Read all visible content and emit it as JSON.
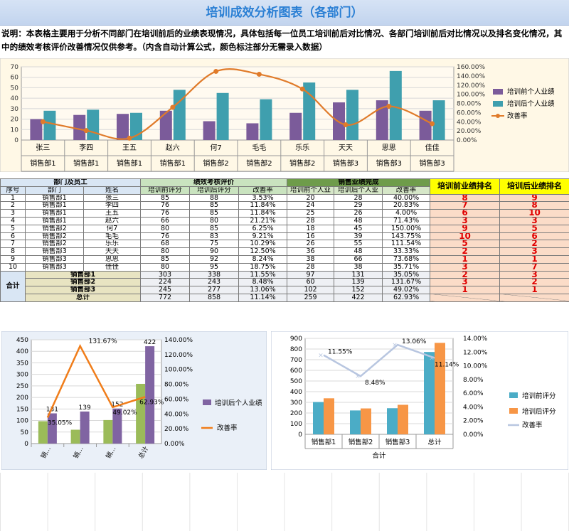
{
  "title": "培训成效分析图表（各部门）",
  "description": "说明：本表格主要用于分析不同部门在培训前后的业绩表现情况，具体包括每一位员工培训前后对比情况、各部门培训前后对比情况以及排名变化情况，其中的绩效考核评价改善情况仅供参考。（内含自动计算公式，颜色标注部分无需录入数据）",
  "table": {
    "group_headers": {
      "dept": "部门及员工",
      "perf": "绩效考核评价",
      "sales": "销售业绩完成",
      "rank_before": "培训前业绩排名",
      "rank_after": "培训后业绩排名"
    },
    "sub_headers": {
      "no": "序号",
      "dept": "部门",
      "name": "姓名",
      "perf_before": "培训前评分",
      "perf_after": "培训后评分",
      "perf_rate": "改善率",
      "sales_before": "培训前个人业",
      "sales_after": "培训后个人业",
      "sales_rate": "改善率"
    },
    "rows": [
      {
        "no": "1",
        "dept": "销售部1",
        "name": "张三",
        "pb": "85",
        "pa": "88",
        "pr": "3.53%",
        "sb": "20",
        "sa": "28",
        "sr": "40.00%",
        "rb": "8",
        "ra": "9"
      },
      {
        "no": "2",
        "dept": "销售部1",
        "name": "李四",
        "pb": "76",
        "pa": "85",
        "pr": "11.84%",
        "sb": "24",
        "sa": "29",
        "sr": "20.83%",
        "rb": "7",
        "ra": "8"
      },
      {
        "no": "3",
        "dept": "销售部1",
        "name": "王五",
        "pb": "76",
        "pa": "85",
        "pr": "11.84%",
        "sb": "25",
        "sa": "26",
        "sr": "4.00%",
        "rb": "6",
        "ra": "10"
      },
      {
        "no": "4",
        "dept": "销售部1",
        "name": "赵六",
        "pb": "66",
        "pa": "80",
        "pr": "21.21%",
        "sb": "28",
        "sa": "48",
        "sr": "71.43%",
        "rb": "3",
        "ra": "3"
      },
      {
        "no": "5",
        "dept": "销售部2",
        "name": "何7",
        "pb": "80",
        "pa": "85",
        "pr": "6.25%",
        "sb": "18",
        "sa": "45",
        "sr": "150.00%",
        "rb": "9",
        "ra": "5"
      },
      {
        "no": "6",
        "dept": "销售部2",
        "name": "毛毛",
        "pb": "76",
        "pa": "83",
        "pr": "9.21%",
        "sb": "16",
        "sa": "39",
        "sr": "143.75%",
        "rb": "10",
        "ra": "6"
      },
      {
        "no": "7",
        "dept": "销售部2",
        "name": "乐乐",
        "pb": "68",
        "pa": "75",
        "pr": "10.29%",
        "sb": "26",
        "sa": "55",
        "sr": "111.54%",
        "rb": "5",
        "ra": "2"
      },
      {
        "no": "8",
        "dept": "销售部3",
        "name": "天天",
        "pb": "80",
        "pa": "90",
        "pr": "12.50%",
        "sb": "36",
        "sa": "48",
        "sr": "33.33%",
        "rb": "2",
        "ra": "3"
      },
      {
        "no": "9",
        "dept": "销售部3",
        "name": "思思",
        "pb": "85",
        "pa": "92",
        "pr": "8.24%",
        "sb": "38",
        "sa": "66",
        "sr": "73.68%",
        "rb": "1",
        "ra": "1"
      },
      {
        "no": "10",
        "dept": "销售部3",
        "name": "佳佳",
        "pb": "80",
        "pa": "95",
        "pr": "18.75%",
        "sb": "28",
        "sa": "38",
        "sr": "35.71%",
        "rb": "3",
        "ra": "7"
      }
    ],
    "total_label": "合计",
    "dept_totals": [
      {
        "dept": "销售部1",
        "pb": "303",
        "pa": "338",
        "pr": "11.55%",
        "sb": "97",
        "sa": "131",
        "sr": "35.05%",
        "rb": "2",
        "ra": "3"
      },
      {
        "dept": "销售部2",
        "pb": "224",
        "pa": "243",
        "pr": "8.48%",
        "sb": "60",
        "sa": "139",
        "sr": "131.67%",
        "rb": "3",
        "ra": "2"
      },
      {
        "dept": "销售部3",
        "pb": "245",
        "pa": "277",
        "pr": "13.06%",
        "sb": "102",
        "sa": "152",
        "sr": "49.02%",
        "rb": "1",
        "ra": "1"
      }
    ],
    "grand_total": {
      "dept": "总计",
      "pb": "772",
      "pa": "858",
      "pr": "11.14%",
      "sb": "259",
      "sa": "422",
      "sr": "62.93%"
    }
  },
  "chart_data": [
    {
      "type": "bar",
      "categories": [
        "张三",
        "李四",
        "王五",
        "赵六",
        "何7",
        "毛毛",
        "乐乐",
        "天天",
        "思思",
        "佳佳"
      ],
      "category_groups": [
        "销售部1",
        "销售部1",
        "销售部1",
        "销售部1",
        "销售部2",
        "销售部2",
        "销售部2",
        "销售部3",
        "销售部3",
        "销售部3"
      ],
      "series": [
        {
          "name": "培训前个人业绩",
          "type": "bar",
          "values": [
            20,
            24,
            25,
            28,
            18,
            16,
            26,
            36,
            38,
            28
          ],
          "color": "#7b5b9a"
        },
        {
          "name": "培训后个人业绩",
          "type": "bar",
          "values": [
            28,
            29,
            26,
            48,
            45,
            39,
            55,
            48,
            66,
            38
          ],
          "color": "#3f9fae"
        },
        {
          "name": "改善率",
          "type": "line",
          "axis": "right",
          "values": [
            40.0,
            20.83,
            4.0,
            71.43,
            150.0,
            143.75,
            111.54,
            33.33,
            73.68,
            35.71
          ],
          "color": "#e07b2a"
        }
      ],
      "ylim": [
        0,
        70
      ],
      "yticks": [
        "0",
        "10",
        "20",
        "30",
        "40",
        "50",
        "60",
        "70"
      ],
      "y2lim": [
        0,
        160
      ],
      "y2ticks": [
        "0.00%",
        "20.00%",
        "40.00%",
        "60.00%",
        "80.00%",
        "100.00%",
        "120.00%",
        "140.00%",
        "160.00%"
      ],
      "legend": [
        "培训前个人业绩",
        "培训后个人业绩",
        "改善率"
      ],
      "legend_position": "right",
      "grid": true
    },
    {
      "type": "bar",
      "categories": [
        "销…",
        "销…",
        "销…",
        "总计"
      ],
      "series": [
        {
          "name": "",
          "type": "bar",
          "values": [
            97,
            60,
            102,
            259
          ],
          "color": "#9bbb59"
        },
        {
          "name": "培训后个人业绩",
          "type": "bar",
          "values": [
            131,
            139,
            152,
            422
          ],
          "color": "#8064a2"
        },
        {
          "name": "改善率",
          "type": "line",
          "axis": "right",
          "values": [
            35.05,
            131.67,
            49.02,
            62.93
          ],
          "color": "#f07d1a"
        }
      ],
      "bar_labels": [
        "131",
        "139",
        "152",
        "422"
      ],
      "rate_labels": [
        "35.05%",
        "131.67%",
        "49.02%",
        "62.93%"
      ],
      "ylim": [
        0,
        450
      ],
      "yticks": [
        "0",
        "50",
        "100",
        "150",
        "200",
        "250",
        "300",
        "350",
        "400",
        "450"
      ],
      "y2lim": [
        0,
        140
      ],
      "y2ticks": [
        "0.00%",
        "20.00%",
        "40.00%",
        "60.00%",
        "80.00%",
        "100.00%",
        "120.00%",
        "140.00%"
      ],
      "legend": [
        "培训后个人业绩",
        "改善率"
      ],
      "legend_position": "right",
      "grid": true
    },
    {
      "type": "bar",
      "categories": [
        "销售部1",
        "销售部2",
        "销售部3",
        "总计"
      ],
      "xlabel": "合计",
      "series": [
        {
          "name": "培训前评分",
          "type": "bar",
          "values": [
            303,
            224,
            245,
            772
          ],
          "color": "#4bacc6"
        },
        {
          "name": "培训后评分",
          "type": "bar",
          "values": [
            338,
            243,
            277,
            858
          ],
          "color": "#f79646"
        },
        {
          "name": "改善率",
          "type": "line",
          "axis": "right",
          "values": [
            11.55,
            8.48,
            13.06,
            11.14
          ],
          "color": "#b8c6e0"
        }
      ],
      "rate_labels": [
        "11.55%",
        "8.48%",
        "13.06%",
        "11.14%"
      ],
      "ylim": [
        0,
        900
      ],
      "yticks": [
        "0",
        "100",
        "200",
        "300",
        "400",
        "500",
        "600",
        "700",
        "800",
        "900"
      ],
      "y2lim": [
        0,
        14
      ],
      "y2ticks": [
        "0.00%",
        "2.00%",
        "4.00%",
        "6.00%",
        "8.00%",
        "10.00%",
        "12.00%",
        "14.00%"
      ],
      "legend": [
        "培训前评分",
        "培训后评分",
        "改善率"
      ],
      "legend_position": "right",
      "grid": true
    }
  ]
}
